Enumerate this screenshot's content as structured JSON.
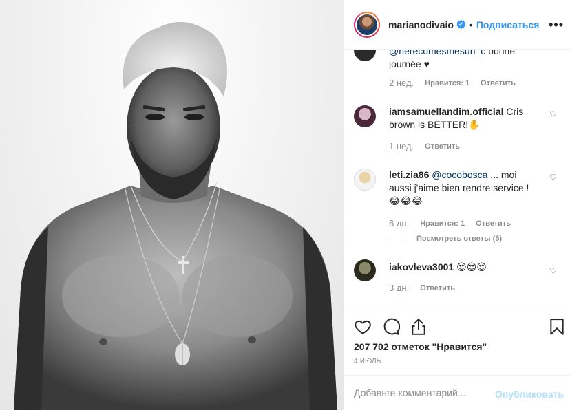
{
  "header": {
    "username": "marianodivaio",
    "verified_glyph": "✔",
    "separator": "•",
    "follow_label": "Подписаться",
    "more_label": "•••"
  },
  "comments": [
    {
      "partial_text_line1": "@herecomesthesun_c bonne",
      "partial_text_mention": "@herecomesthesun_c",
      "partial_text_rest": " bonne",
      "text_line2": "journée ♥",
      "time": "2 нед.",
      "likes": "Нравится: 1",
      "reply": "Ответить"
    },
    {
      "user": "iamsamuellandim.official",
      "text": " Cris brown is BETTER!✋",
      "time": "1 нед.",
      "reply": "Ответить"
    },
    {
      "user": "leti.zia86",
      "mention": "@cocobosca",
      "text": " ... moi aussi j'aime bien rendre service ! 😂😂😂",
      "time": "6 дн.",
      "likes": "Нравится: 1",
      "reply": "Ответить",
      "view_replies": "Посмотреть ответы (5)"
    },
    {
      "user": "iakovleva3001",
      "text": " 😍😍😍",
      "time": "3 дн.",
      "reply": "Ответить"
    }
  ],
  "actions": {
    "likes": "207 702 отметок \"Нравится\"",
    "date": "4 ИЮЛЬ"
  },
  "add_comment": {
    "placeholder": "Добавьте комментарий...",
    "publish_label": "Опубликовать"
  },
  "icons": {
    "heart_small": "♡"
  },
  "colors": {
    "accent": "#3897f0",
    "publish_disabled": "#b2dffc",
    "meta_gray": "#8e8e8e",
    "text": "#262626"
  }
}
